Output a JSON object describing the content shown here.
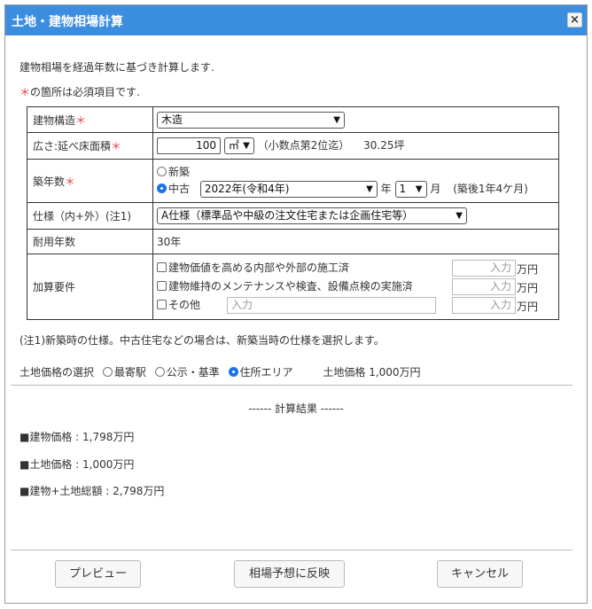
{
  "dialog": {
    "title": "土地・建物相場計算",
    "close_label": "×"
  },
  "intro": {
    "line1": "建物相場を経過年数に基づき計算します.",
    "req_mark": "＊",
    "line2": "の箇所は必須項目です."
  },
  "form": {
    "structure": {
      "label": "建物構造",
      "value": "木造"
    },
    "area": {
      "label": "広さ:延べ床面積",
      "value": "100",
      "unit": "㎡",
      "hint": "（小数点第2位迄）",
      "tsubo": "30.25坪"
    },
    "age": {
      "label": "築年数",
      "opt_new": "新築",
      "opt_used": "中古",
      "year_value": "2022年(令和4年)",
      "year_suffix": "年",
      "month_value": "1",
      "month_suffix": "月",
      "elapsed": "(築後1年4ケ月)"
    },
    "spec": {
      "label": "仕様（内+外）(注1)",
      "value": "A仕様（標準品や中級の注文住宅または企画住宅等）"
    },
    "life": {
      "label": "耐用年数",
      "value": "30年"
    },
    "additions": {
      "label": "加算要件",
      "items": [
        {
          "label": "建物価値を高める内部や外部の施工済",
          "placeholder": "入力",
          "unit": "万円"
        },
        {
          "label": "建物維持のメンテナンスや検査、設備点検の実施済",
          "placeholder": "入力",
          "unit": "万円"
        },
        {
          "label": "その他",
          "text_placeholder": "入力",
          "placeholder": "入力",
          "unit": "万円"
        }
      ]
    },
    "note": "(注1)新築時の仕様。中古住宅などの場合は、新築当時の仕様を選択します。"
  },
  "land": {
    "label": "土地価格の選択",
    "options": [
      "最寄駅",
      "公示・基準",
      "住所エリア"
    ],
    "selected_index": 2,
    "price": "土地価格 1,000万円"
  },
  "result": {
    "heading": "------ 計算結果 ------",
    "building": "■建物価格 : 1,798万円",
    "land": "■土地価格 : 1,000万円",
    "total": "■建物+土地総額 : 2,798万円"
  },
  "buttons": {
    "preview": "プレビュー",
    "apply": "相場予想に反映",
    "cancel": "キャンセル"
  },
  "colors": {
    "titlebar": "#3a8ddf",
    "required": "#e04040",
    "radio_selected": "#1a73e8"
  }
}
